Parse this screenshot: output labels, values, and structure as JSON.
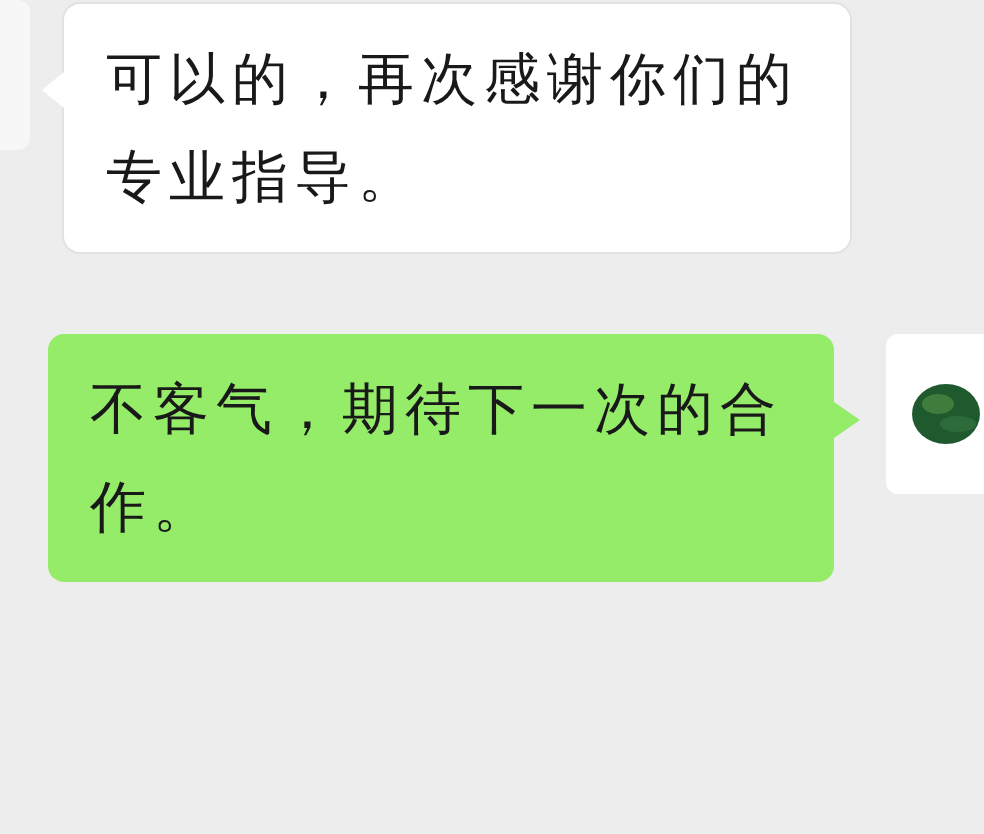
{
  "messages": [
    {
      "kind": "received",
      "text": "可以的，再次感谢你们的专业指导。"
    },
    {
      "kind": "sent",
      "text": "不客气，期待下一次的合作。"
    }
  ]
}
